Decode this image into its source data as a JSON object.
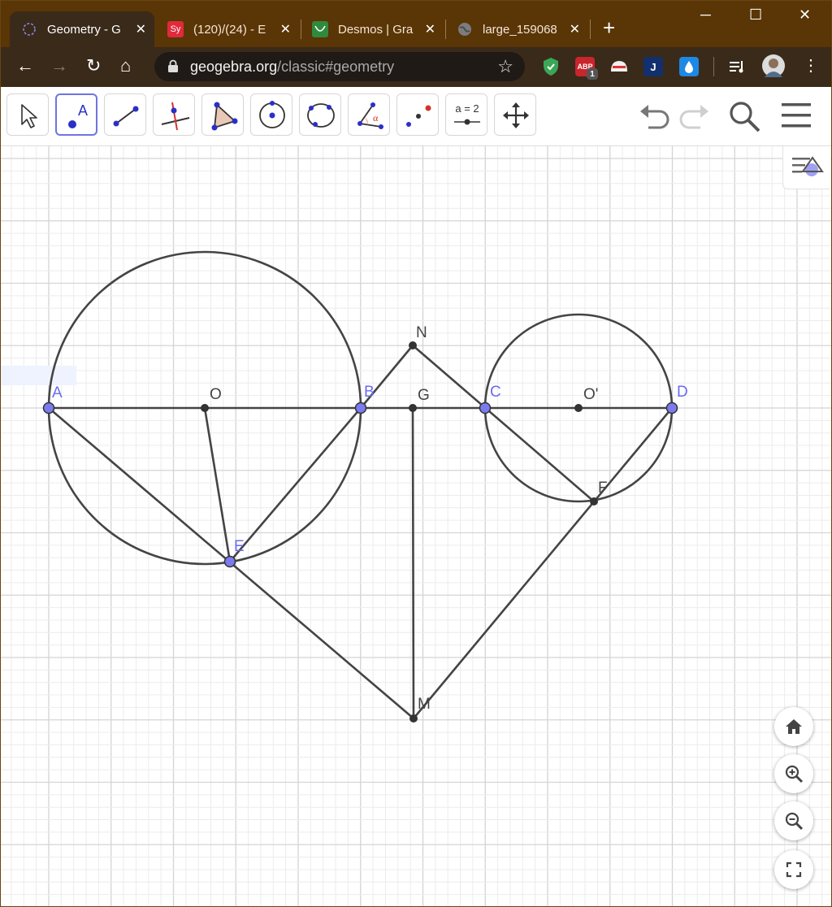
{
  "tabs": [
    {
      "title": "Geometry - G",
      "active": true
    },
    {
      "title": "(120)/(24) - E",
      "active": false
    },
    {
      "title": "Desmos | Gra",
      "active": false
    },
    {
      "title": "large_159068",
      "active": false
    }
  ],
  "tab_icons": {
    "tab2": "Sy"
  },
  "window": {
    "minimize": "─",
    "maximize": "☐",
    "close": "✕",
    "new_tab": "+"
  },
  "address": {
    "host": "geogebra.org",
    "path": "/classic#geometry"
  },
  "extensions": {
    "abp_badge": "1",
    "j_ext": "J"
  },
  "toolbar": {
    "slider_label": "a = 2"
  },
  "points": {
    "A": "A",
    "O": "O",
    "B": "B",
    "G": "G",
    "N": "N",
    "C": "C",
    "O2": "O'",
    "D": "D",
    "E": "E",
    "F": "F",
    "M": "M"
  },
  "colors": {
    "browser_frame": "#5a3506",
    "toolbar_dark": "#3a2a1a",
    "free_point": "#7b7bf0",
    "dependent_point": "#333333",
    "geo_line": "#444444",
    "grid_major": "#d4d4d4",
    "grid_minor": "#ececec",
    "tool_select": "#6f74e0"
  }
}
